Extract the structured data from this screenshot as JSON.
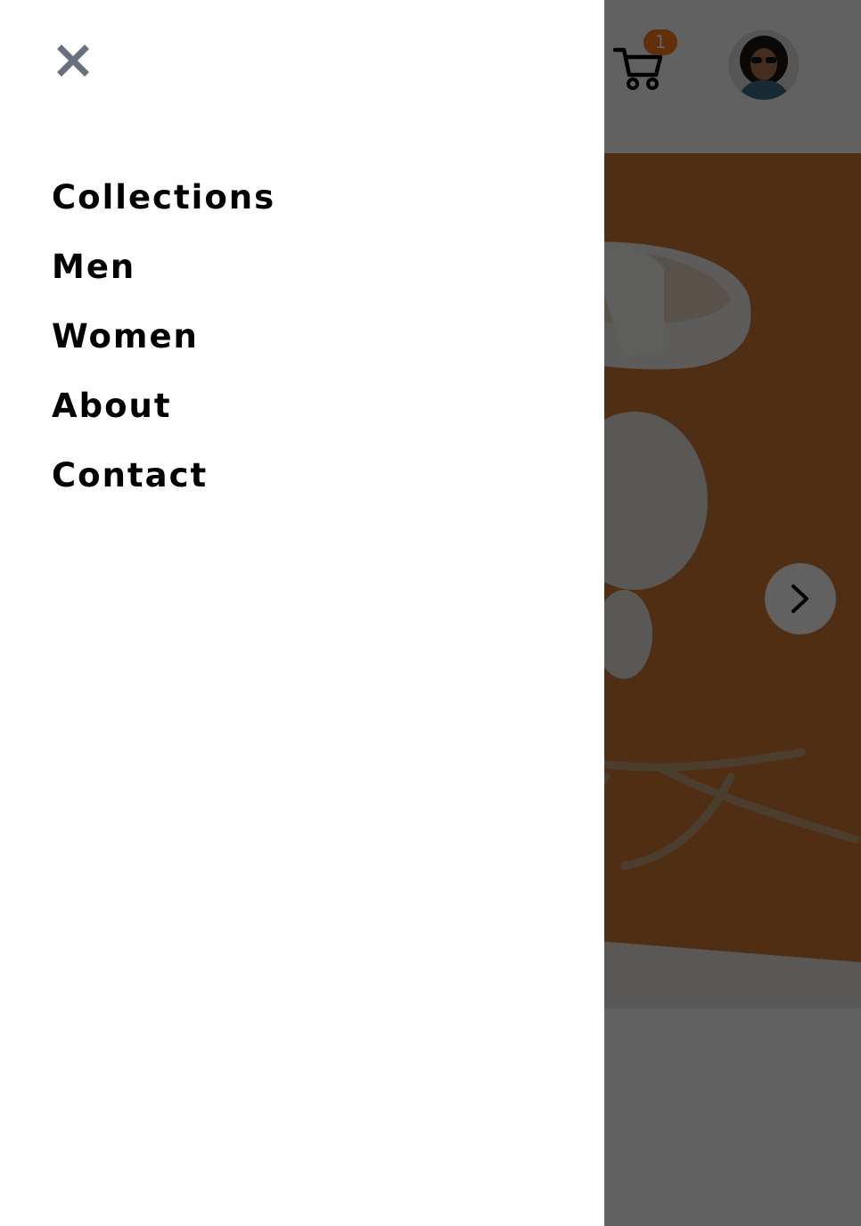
{
  "header": {
    "cart": {
      "count": "1",
      "icon": "cart-icon"
    },
    "avatar": {
      "icon": "user-avatar"
    }
  },
  "hero": {
    "next_icon": "chevron-right-icon",
    "background_color": "#d17a36"
  },
  "drawer": {
    "close_icon": "close-icon",
    "nav": [
      {
        "label": "Collections"
      },
      {
        "label": "Men"
      },
      {
        "label": "Women"
      },
      {
        "label": "About"
      },
      {
        "label": "Contact"
      }
    ]
  },
  "colors": {
    "accent": "#ff7e1b",
    "close_icon": "#69707d",
    "text": "#000000"
  }
}
